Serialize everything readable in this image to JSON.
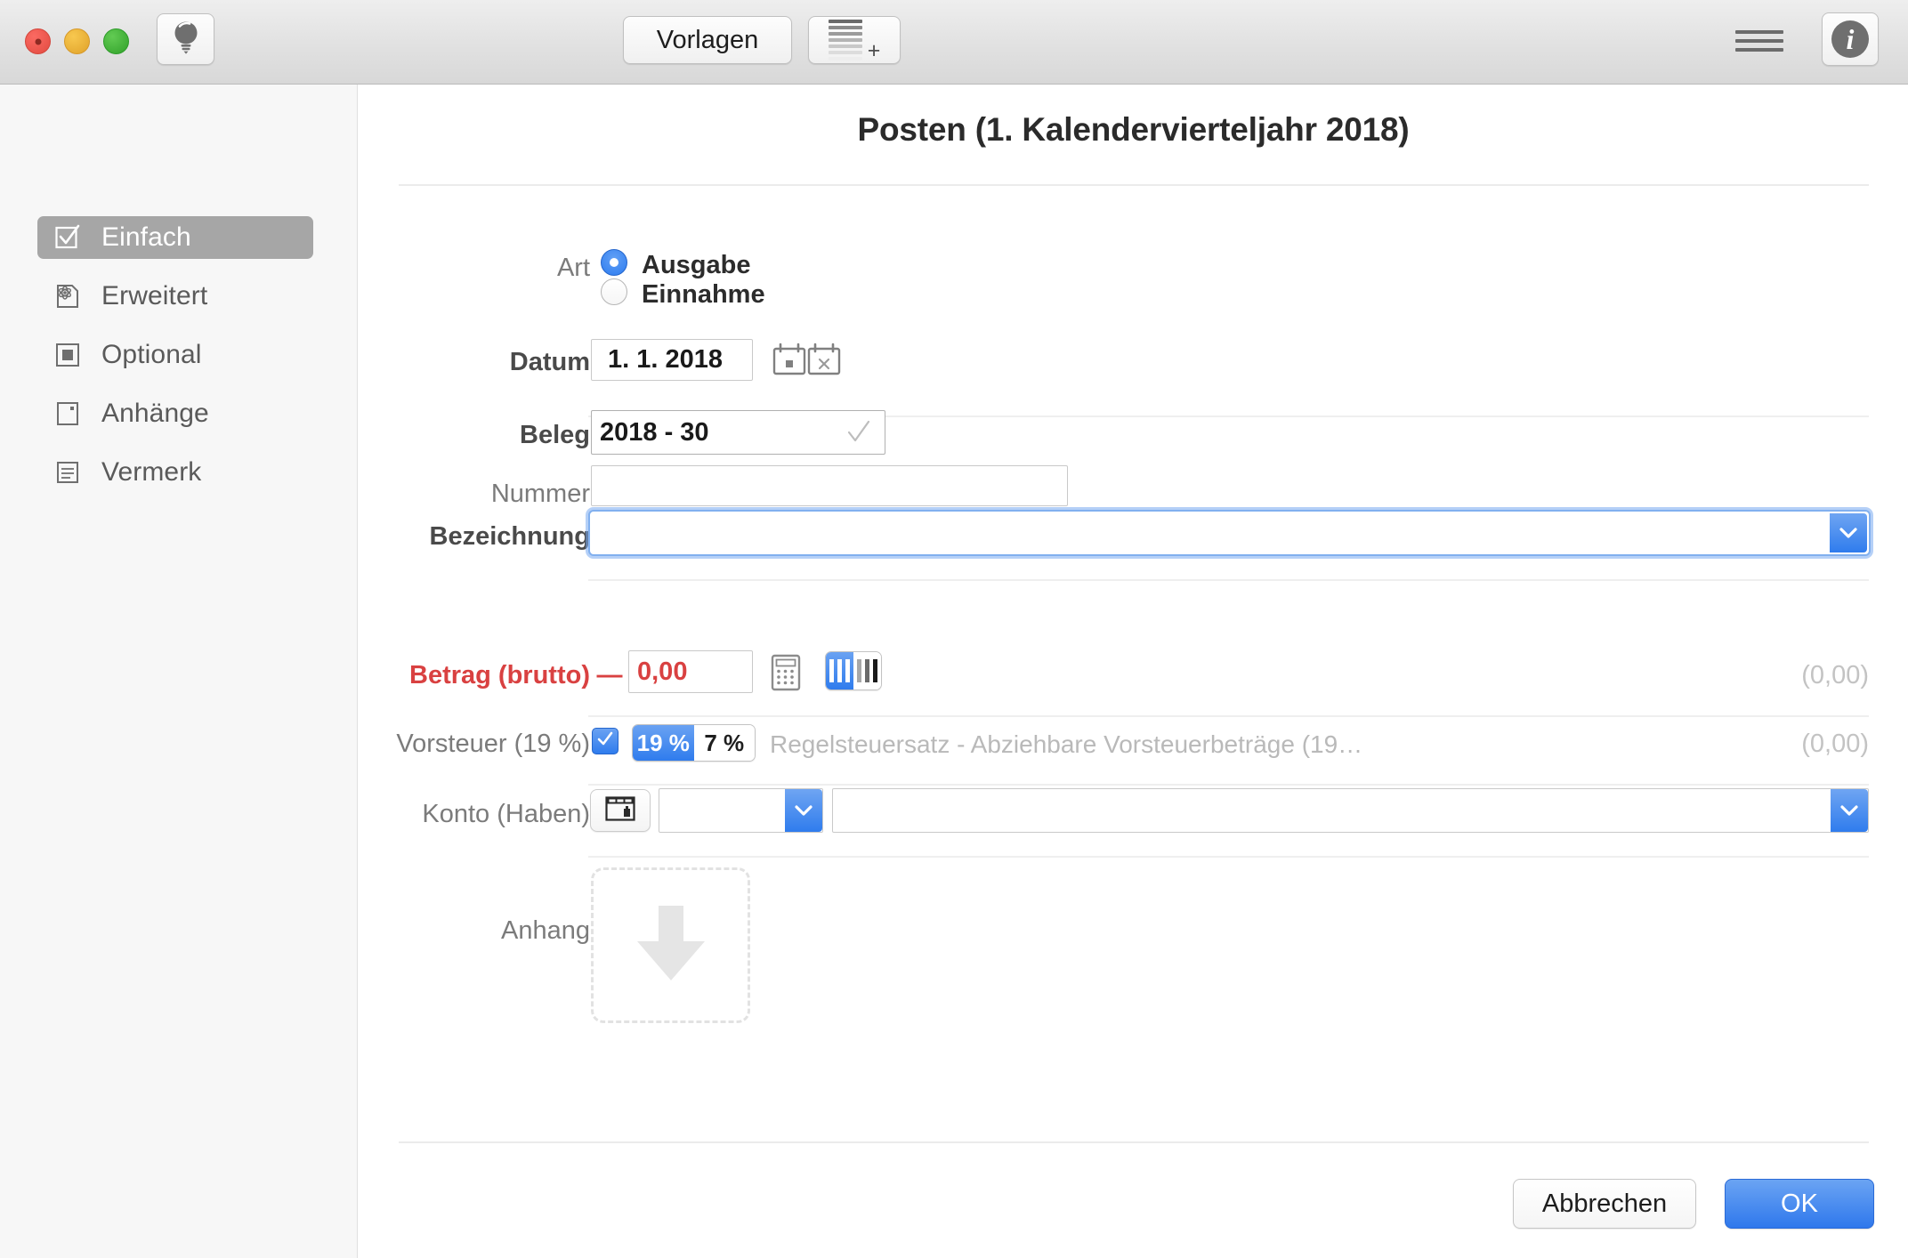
{
  "window": {
    "toolbar": {
      "bulb_icon": "lightbulb-icon",
      "templates_label": "Vorlagen",
      "new_doc_icon": "document-add-icon",
      "list_icon": "hamburger-icon",
      "info_icon": "info-icon",
      "info_glyph": "i"
    }
  },
  "sidebar": {
    "items": [
      {
        "label": "Einfach",
        "icon": "checkbox-checked-icon",
        "selected": true
      },
      {
        "label": "Erweitert",
        "icon": "atom-document-icon",
        "selected": false
      },
      {
        "label": "Optional",
        "icon": "filled-square-icon",
        "selected": false
      },
      {
        "label": "Anhänge",
        "icon": "page-dot-icon",
        "selected": false
      },
      {
        "label": "Vermerk",
        "icon": "note-lines-icon",
        "selected": false
      }
    ]
  },
  "dialog": {
    "title": "Posten (1. Kalendervierteljahr 2018)",
    "art": {
      "label": "Art",
      "options": [
        {
          "label": "Ausgabe",
          "selected": true
        },
        {
          "label": "Einnahme",
          "selected": false
        }
      ]
    },
    "datum": {
      "label": "Datum",
      "value": "1.  1. 2018",
      "today_icon": "calendar-today-icon",
      "clear_icon": "calendar-clear-icon"
    },
    "beleg": {
      "label": "Beleg",
      "value": "2018 - 30",
      "check_icon": "checkmark-icon"
    },
    "nummer": {
      "label": "Nummer",
      "value": "",
      "placeholder": ""
    },
    "bezeichnung": {
      "label": "Bezeichnung",
      "value": "",
      "placeholder": "",
      "dropdown_icon": "chevron-down-icon"
    },
    "betrag": {
      "label": "Betrag (brutto)",
      "sign": "—",
      "value": "0,00",
      "calculator_icon": "calculator-icon",
      "toggle": [
        {
          "icon": "bars-light-icon",
          "selected": true
        },
        {
          "icon": "bars-dark-icon",
          "selected": false
        }
      ],
      "computed": "(0,00)"
    },
    "vorsteuer": {
      "label": "Vorsteuer (19 %)",
      "checked": true,
      "check_icon": "checkmark-icon",
      "rates": [
        {
          "label": "19 %",
          "selected": true
        },
        {
          "label": "7 %",
          "selected": false
        }
      ],
      "description": "Regelsteuersatz - Abziehbare Vorsteuerbeträge (19…",
      "computed": "(0,00)"
    },
    "konto": {
      "label": "Konto (Haben)",
      "ledger_icon": "ledger-window-icon",
      "group_value": "",
      "group_dropdown_icon": "chevron-down-icon",
      "account_value": "",
      "account_dropdown_icon": "chevron-down-icon"
    },
    "anhang": {
      "label": "Anhang",
      "dropzone_icon": "download-arrow-icon"
    },
    "buttons": {
      "cancel": "Abbrechen",
      "ok": "OK"
    }
  },
  "colors": {
    "accent_blue": "#2f7ced",
    "error_red": "#d94141",
    "sidebar_selected": "#a6a6a6",
    "muted_gray": "#b9b9b9"
  }
}
